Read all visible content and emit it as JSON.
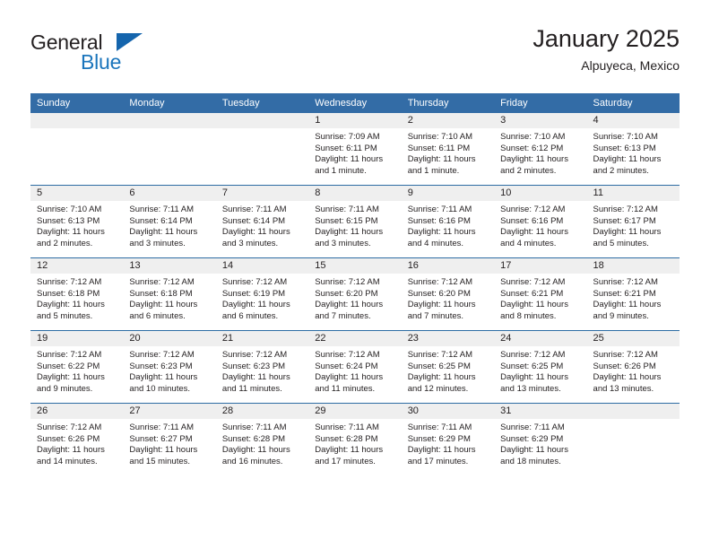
{
  "brand": {
    "name_part1": "General",
    "name_part2": "Blue",
    "triangle_color": "#1565ad",
    "blue_color": "#1b75bc"
  },
  "header": {
    "title": "January 2025",
    "subtitle": "Alpuyeca, Mexico"
  },
  "theme": {
    "header_band": "#336ca6",
    "row_divider": "#2e6da4",
    "daynum_band": "#efefef",
    "text": "#231f20"
  },
  "weekdays": [
    "Sunday",
    "Monday",
    "Tuesday",
    "Wednesday",
    "Thursday",
    "Friday",
    "Saturday"
  ],
  "weeks": [
    [
      {
        "day": "",
        "empty": true
      },
      {
        "day": "",
        "empty": true
      },
      {
        "day": "",
        "empty": true
      },
      {
        "day": "1",
        "sunrise": "Sunrise: 7:09 AM",
        "sunset": "Sunset: 6:11 PM",
        "daylight": "Daylight: 11 hours and 1 minute."
      },
      {
        "day": "2",
        "sunrise": "Sunrise: 7:10 AM",
        "sunset": "Sunset: 6:11 PM",
        "daylight": "Daylight: 11 hours and 1 minute."
      },
      {
        "day": "3",
        "sunrise": "Sunrise: 7:10 AM",
        "sunset": "Sunset: 6:12 PM",
        "daylight": "Daylight: 11 hours and 2 minutes."
      },
      {
        "day": "4",
        "sunrise": "Sunrise: 7:10 AM",
        "sunset": "Sunset: 6:13 PM",
        "daylight": "Daylight: 11 hours and 2 minutes."
      }
    ],
    [
      {
        "day": "5",
        "sunrise": "Sunrise: 7:10 AM",
        "sunset": "Sunset: 6:13 PM",
        "daylight": "Daylight: 11 hours and 2 minutes."
      },
      {
        "day": "6",
        "sunrise": "Sunrise: 7:11 AM",
        "sunset": "Sunset: 6:14 PM",
        "daylight": "Daylight: 11 hours and 3 minutes."
      },
      {
        "day": "7",
        "sunrise": "Sunrise: 7:11 AM",
        "sunset": "Sunset: 6:14 PM",
        "daylight": "Daylight: 11 hours and 3 minutes."
      },
      {
        "day": "8",
        "sunrise": "Sunrise: 7:11 AM",
        "sunset": "Sunset: 6:15 PM",
        "daylight": "Daylight: 11 hours and 3 minutes."
      },
      {
        "day": "9",
        "sunrise": "Sunrise: 7:11 AM",
        "sunset": "Sunset: 6:16 PM",
        "daylight": "Daylight: 11 hours and 4 minutes."
      },
      {
        "day": "10",
        "sunrise": "Sunrise: 7:12 AM",
        "sunset": "Sunset: 6:16 PM",
        "daylight": "Daylight: 11 hours and 4 minutes."
      },
      {
        "day": "11",
        "sunrise": "Sunrise: 7:12 AM",
        "sunset": "Sunset: 6:17 PM",
        "daylight": "Daylight: 11 hours and 5 minutes."
      }
    ],
    [
      {
        "day": "12",
        "sunrise": "Sunrise: 7:12 AM",
        "sunset": "Sunset: 6:18 PM",
        "daylight": "Daylight: 11 hours and 5 minutes."
      },
      {
        "day": "13",
        "sunrise": "Sunrise: 7:12 AM",
        "sunset": "Sunset: 6:18 PM",
        "daylight": "Daylight: 11 hours and 6 minutes."
      },
      {
        "day": "14",
        "sunrise": "Sunrise: 7:12 AM",
        "sunset": "Sunset: 6:19 PM",
        "daylight": "Daylight: 11 hours and 6 minutes."
      },
      {
        "day": "15",
        "sunrise": "Sunrise: 7:12 AM",
        "sunset": "Sunset: 6:20 PM",
        "daylight": "Daylight: 11 hours and 7 minutes."
      },
      {
        "day": "16",
        "sunrise": "Sunrise: 7:12 AM",
        "sunset": "Sunset: 6:20 PM",
        "daylight": "Daylight: 11 hours and 7 minutes."
      },
      {
        "day": "17",
        "sunrise": "Sunrise: 7:12 AM",
        "sunset": "Sunset: 6:21 PM",
        "daylight": "Daylight: 11 hours and 8 minutes."
      },
      {
        "day": "18",
        "sunrise": "Sunrise: 7:12 AM",
        "sunset": "Sunset: 6:21 PM",
        "daylight": "Daylight: 11 hours and 9 minutes."
      }
    ],
    [
      {
        "day": "19",
        "sunrise": "Sunrise: 7:12 AM",
        "sunset": "Sunset: 6:22 PM",
        "daylight": "Daylight: 11 hours and 9 minutes."
      },
      {
        "day": "20",
        "sunrise": "Sunrise: 7:12 AM",
        "sunset": "Sunset: 6:23 PM",
        "daylight": "Daylight: 11 hours and 10 minutes."
      },
      {
        "day": "21",
        "sunrise": "Sunrise: 7:12 AM",
        "sunset": "Sunset: 6:23 PM",
        "daylight": "Daylight: 11 hours and 11 minutes."
      },
      {
        "day": "22",
        "sunrise": "Sunrise: 7:12 AM",
        "sunset": "Sunset: 6:24 PM",
        "daylight": "Daylight: 11 hours and 11 minutes."
      },
      {
        "day": "23",
        "sunrise": "Sunrise: 7:12 AM",
        "sunset": "Sunset: 6:25 PM",
        "daylight": "Daylight: 11 hours and 12 minutes."
      },
      {
        "day": "24",
        "sunrise": "Sunrise: 7:12 AM",
        "sunset": "Sunset: 6:25 PM",
        "daylight": "Daylight: 11 hours and 13 minutes."
      },
      {
        "day": "25",
        "sunrise": "Sunrise: 7:12 AM",
        "sunset": "Sunset: 6:26 PM",
        "daylight": "Daylight: 11 hours and 13 minutes."
      }
    ],
    [
      {
        "day": "26",
        "sunrise": "Sunrise: 7:12 AM",
        "sunset": "Sunset: 6:26 PM",
        "daylight": "Daylight: 11 hours and 14 minutes."
      },
      {
        "day": "27",
        "sunrise": "Sunrise: 7:11 AM",
        "sunset": "Sunset: 6:27 PM",
        "daylight": "Daylight: 11 hours and 15 minutes."
      },
      {
        "day": "28",
        "sunrise": "Sunrise: 7:11 AM",
        "sunset": "Sunset: 6:28 PM",
        "daylight": "Daylight: 11 hours and 16 minutes."
      },
      {
        "day": "29",
        "sunrise": "Sunrise: 7:11 AM",
        "sunset": "Sunset: 6:28 PM",
        "daylight": "Daylight: 11 hours and 17 minutes."
      },
      {
        "day": "30",
        "sunrise": "Sunrise: 7:11 AM",
        "sunset": "Sunset: 6:29 PM",
        "daylight": "Daylight: 11 hours and 17 minutes."
      },
      {
        "day": "31",
        "sunrise": "Sunrise: 7:11 AM",
        "sunset": "Sunset: 6:29 PM",
        "daylight": "Daylight: 11 hours and 18 minutes."
      },
      {
        "day": "",
        "empty": true
      }
    ]
  ]
}
